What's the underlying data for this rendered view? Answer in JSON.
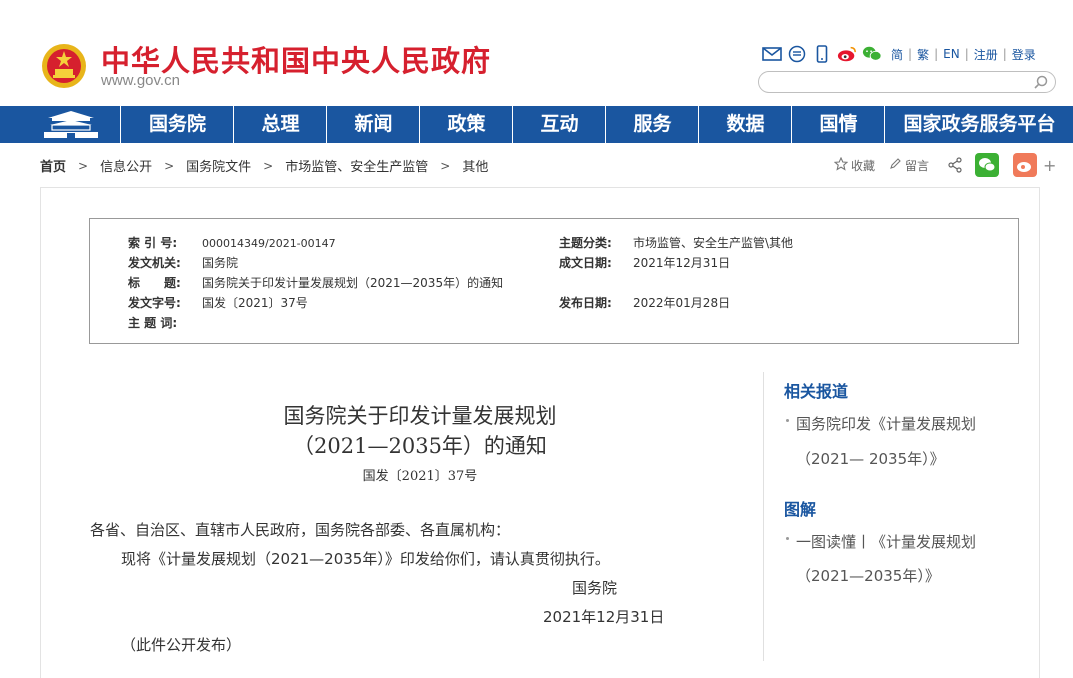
{
  "header": {
    "site_name": "中华人民共和国中央人民政府",
    "site_url": "www.gov.cn",
    "lang": {
      "simplified": "简",
      "traditional": "繁",
      "english": "EN",
      "register": "注册",
      "login": "登录",
      "sep": "|"
    }
  },
  "nav": {
    "items": [
      "国务院",
      "总理",
      "新闻",
      "政策",
      "互动",
      "服务",
      "数据",
      "国情",
      "国家政务服务平台"
    ]
  },
  "breadcrumb": {
    "home": "首页",
    "items": [
      "信息公开",
      "国务院文件",
      "市场监管、安全生产监管",
      "其他"
    ],
    "arrow": ">"
  },
  "share": {
    "favorite": "收藏",
    "comment": "留言",
    "plus": "+"
  },
  "meta": {
    "index_label": "索 引 号:",
    "index_value": "000014349/2021-00147",
    "topic_label": "主题分类:",
    "topic_value": "市场监管、安全生产监管\\其他",
    "issuer_label": "发文机关:",
    "issuer_value": "国务院",
    "date_written_label": "成文日期:",
    "date_written_value": "2021年12月31日",
    "title_label": "标　　题:",
    "title_value": "国务院关于印发计量发展规划（2021—2035年）的通知",
    "doc_no_label": "发文字号:",
    "doc_no_value": "国发〔2021〕37号",
    "publish_label": "发布日期:",
    "publish_value": "2022年01月28日",
    "keywords_label": "主 题 词:"
  },
  "doc": {
    "title_line1": "国务院关于印发计量发展规划",
    "title_line2": "（2021—2035年）的通知",
    "doc_no": "国发〔2021〕37号",
    "addressee": "各省、自治区、直辖市人民政府，国务院各部委、各直属机构：",
    "body": "现将《计量发展规划（2021—2035年）》印发给你们，请认真贯彻执行。",
    "signer": "国务院",
    "date": "2021年12月31日",
    "note": "（此件公开发布）"
  },
  "sidebar": {
    "related_heading": "相关报道",
    "related_line1": "国务院印发《计量发展规划",
    "related_line2": "（2021— 2035年）》",
    "diagram_heading": "图解",
    "diagram_line1": "一图读懂丨《计量发展规划",
    "diagram_line2": "（2021—2035年）》"
  },
  "colors": {
    "brand_red": "#d6202e",
    "nav_blue": "#1a56a0",
    "wechat_green": "#3cb034",
    "weibo_orange": "#f07a5a"
  }
}
